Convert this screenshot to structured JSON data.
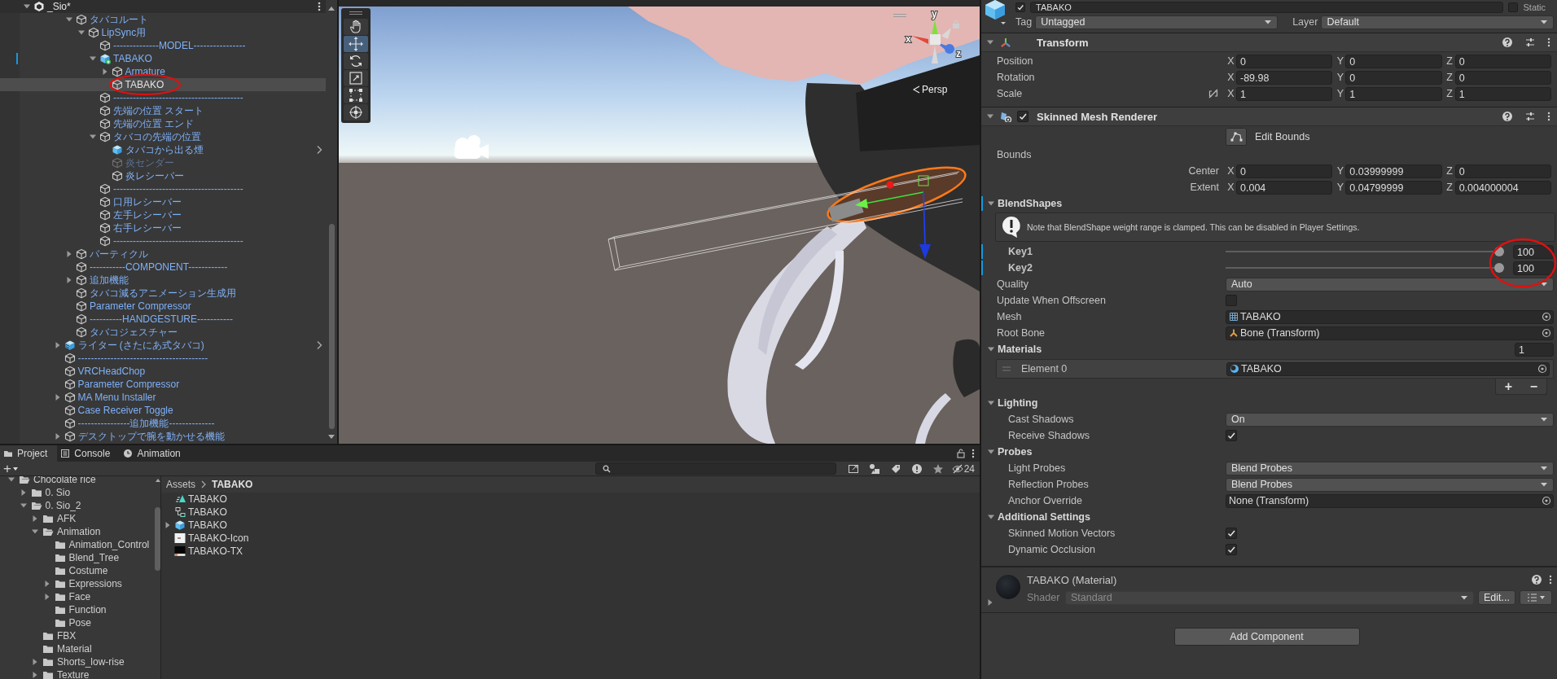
{
  "hierarchy": {
    "scene": {
      "label": "_Sio*",
      "expanded": true
    },
    "nested_nodes": [
      {
        "label": "タバコルート",
        "kind": "object",
        "expanded": true,
        "selected": false,
        "inactive": false,
        "overridden": false,
        "children": [
          {
            "label": "LipSync用",
            "kind": "object",
            "expanded": true,
            "selected": false,
            "inactive": false,
            "overridden": false,
            "children": [
              {
                "label": "--------------MODEL----------------",
                "kind": "object",
                "selected": false,
                "inactive": false,
                "overridden": false
              },
              {
                "label": "TABAKO",
                "kind": "model_added",
                "expanded": true,
                "selected": false,
                "inactive": false,
                "overridden": true,
                "children": [
                  {
                    "label": "Armature",
                    "kind": "object",
                    "expanded": false,
                    "selected": false,
                    "inactive": false,
                    "overridden": false
                  },
                  {
                    "label": "TABAKO",
                    "kind": "object",
                    "selected": true,
                    "inactive": false,
                    "overridden": false
                  }
                ]
              },
              {
                "label": "----------------------------------------",
                "kind": "object",
                "selected": false,
                "inactive": false,
                "overridden": false
              },
              {
                "label": "先端の位置 スタート",
                "kind": "object",
                "selected": false,
                "inactive": false,
                "overridden": false
              },
              {
                "label": "先端の位置 エンド",
                "kind": "object",
                "selected": false,
                "inactive": false,
                "overridden": false
              },
              {
                "label": "タバコの先端の位置",
                "kind": "object",
                "expanded": true,
                "selected": false,
                "inactive": false,
                "overridden": false,
                "children": [
                  {
                    "label": "タバコから出る煙",
                    "kind": "prefab",
                    "selected": false,
                    "inactive": false,
                    "overridden": false
                  },
                  {
                    "label": "炎センダー",
                    "kind": "object",
                    "selected": false,
                    "inactive": true,
                    "overridden": false
                  },
                  {
                    "label": "炎レシーバー",
                    "kind": "object",
                    "selected": false,
                    "inactive": false,
                    "overridden": false
                  }
                ]
              },
              {
                "label": "----------------------------------------",
                "kind": "object",
                "selected": false,
                "inactive": false,
                "overridden": false
              },
              {
                "label": "口用レシーバー",
                "kind": "object",
                "selected": false,
                "inactive": false,
                "overridden": false
              },
              {
                "label": "左手レシーバー",
                "kind": "object",
                "selected": false,
                "inactive": false,
                "overridden": false
              },
              {
                "label": "右手レシーバー",
                "kind": "object",
                "selected": false,
                "inactive": false,
                "overridden": false
              },
              {
                "label": "----------------------------------------",
                "kind": "object",
                "selected": false,
                "inactive": false,
                "overridden": false
              }
            ]
          }
        ]
      },
      {
        "label": "パーティクル",
        "kind": "object",
        "expanded": false,
        "selected": false,
        "inactive": false,
        "overridden": false
      },
      {
        "label": "-----------COMPONENT------------",
        "kind": "object",
        "selected": false,
        "inactive": false,
        "overridden": false
      },
      {
        "label": "追加機能",
        "kind": "object",
        "expanded": false,
        "selected": false,
        "inactive": false,
        "overridden": false
      },
      {
        "label": "タバコ減るアニメーション生成用",
        "kind": "object",
        "selected": false,
        "inactive": false,
        "overridden": false
      },
      {
        "label": "Parameter Compressor",
        "kind": "object",
        "selected": false,
        "inactive": false,
        "overridden": false
      },
      {
        "label": "----------HANDGESTURE-----------",
        "kind": "object",
        "selected": false,
        "inactive": false,
        "overridden": false
      },
      {
        "label": "タバコジェスチャー",
        "kind": "object",
        "selected": false,
        "inactive": false,
        "overridden": false
      }
    ],
    "nodes": [
      {
        "label": "ライター (さたにあ式タバコ)",
        "kind": "prefab_variant",
        "expanded": false,
        "selected": false,
        "inactive": false,
        "overridden": false
      },
      {
        "label": "----------------------------------------",
        "kind": "object",
        "selected": false,
        "inactive": false,
        "overridden": false
      },
      {
        "label": "VRCHeadChop",
        "kind": "object",
        "selected": false,
        "inactive": false,
        "overridden": false
      },
      {
        "label": "Parameter Compressor",
        "kind": "object",
        "selected": false,
        "inactive": false,
        "overridden": false
      },
      {
        "label": "MA Menu Installer",
        "kind": "object",
        "expanded": false,
        "selected": false,
        "inactive": false,
        "overridden": false
      },
      {
        "label": "Case Receiver Toggle",
        "kind": "object",
        "selected": false,
        "inactive": false,
        "overridden": false
      },
      {
        "label": "----------------追加機能--------------",
        "kind": "object",
        "selected": false,
        "inactive": false,
        "overridden": false
      },
      {
        "label": "デスクトップで腕を動かせる機能",
        "kind": "object",
        "expanded": false,
        "selected": false,
        "inactive": false,
        "overridden": false
      }
    ]
  },
  "scene": {
    "tools": [
      {
        "kind": "hand",
        "selected": false
      },
      {
        "kind": "move",
        "selected": true
      },
      {
        "kind": "rotate",
        "selected": false
      },
      {
        "kind": "scale",
        "selected": false
      },
      {
        "kind": "rect",
        "selected": false
      },
      {
        "kind": "transform",
        "selected": false
      }
    ],
    "axes": [
      "x",
      "y",
      "z"
    ],
    "projection": "Persp"
  },
  "inspector": {
    "object": {
      "name": "TABAKO",
      "active": true,
      "static_label": "Static",
      "static": false,
      "tag_label": "Tag",
      "tag": "Untagged",
      "layer_label": "Layer",
      "layer": "Default"
    },
    "components": [
      {
        "title": "Transform",
        "kind": "transform",
        "expanded": true,
        "rows": [
          {
            "kind": "vector3",
            "label": "Position",
            "fields": [
              {
                "axis": "X",
                "value": "0"
              },
              {
                "axis": "Y",
                "value": "0"
              },
              {
                "axis": "Z",
                "value": "0"
              }
            ]
          },
          {
            "kind": "vector3",
            "label": "Rotation",
            "fields": [
              {
                "axis": "X",
                "value": "-89.98"
              },
              {
                "axis": "Y",
                "value": "0"
              },
              {
                "axis": "Z",
                "value": "0"
              }
            ]
          },
          {
            "kind": "vector3",
            "label": "Scale",
            "proportional": false,
            "fields": [
              {
                "axis": "X",
                "value": "1"
              },
              {
                "axis": "Y",
                "value": "1"
              },
              {
                "axis": "Z",
                "value": "1"
              }
            ]
          }
        ]
      },
      {
        "title": "Skinned Mesh Renderer",
        "kind": "skinned_mesh_renderer",
        "enabled": true,
        "expanded": true,
        "rows": [
          {
            "kind": "button",
            "label": "Edit Bounds"
          },
          {
            "kind": "label",
            "label": "Bounds"
          },
          {
            "kind": "vector3_sub",
            "label": "Center",
            "fields": [
              {
                "axis": "X",
                "value": "0"
              },
              {
                "axis": "Y",
                "value": "0.03999999"
              },
              {
                "axis": "Z",
                "value": "0"
              }
            ]
          },
          {
            "kind": "vector3_sub",
            "label": "Extent",
            "fields": [
              {
                "axis": "X",
                "value": "0.004"
              },
              {
                "axis": "Y",
                "value": "0.04799999"
              },
              {
                "axis": "Z",
                "value": "0.004000004"
              }
            ]
          },
          {
            "kind": "foldout",
            "label": "BlendShapes",
            "expanded": true,
            "overridden": true,
            "children": [
              {
                "kind": "note",
                "text": "Note that BlendShape weight range is clamped. This can be disabled in Player Settings."
              },
              {
                "kind": "slider",
                "label": "Key1",
                "level": 1,
                "value": "100",
                "overridden": true
              },
              {
                "kind": "slider",
                "label": "Key2",
                "level": 1,
                "value": "100",
                "overridden": true
              }
            ]
          },
          {
            "kind": "dropdown",
            "label": "Quality",
            "value": "Auto"
          },
          {
            "kind": "checkbox",
            "label": "Update When Offscreen",
            "checked": false
          },
          {
            "kind": "mesh_field",
            "label": "Mesh",
            "value": "TABAKO"
          },
          {
            "kind": "bone_field",
            "label": "Root Bone",
            "value": "Bone (Transform)"
          },
          {
            "kind": "foldout",
            "label": "Materials",
            "expanded": true,
            "overridden": false,
            "count": "1",
            "children": [
              {
                "kind": "list_element",
                "label": "Element 0",
                "value": "TABAKO"
              },
              {
                "kind": "list_buttons",
                "add": "+",
                "remove": "−"
              }
            ]
          },
          {
            "kind": "foldout",
            "label": "Lighting",
            "expanded": true,
            "overridden": false,
            "children": [
              {
                "kind": "dropdown",
                "label": "Cast Shadows",
                "value": "On"
              },
              {
                "kind": "checkbox",
                "label": "Receive Shadows",
                "checked": true
              }
            ]
          },
          {
            "kind": "foldout",
            "label": "Probes",
            "expanded": true,
            "overridden": false,
            "children": [
              {
                "kind": "dropdown",
                "label": "Light Probes",
                "value": "Blend Probes"
              },
              {
                "kind": "dropdown",
                "label": "Reflection Probes",
                "value": "Blend Probes"
              },
              {
                "kind": "object",
                "label": "Anchor Override",
                "value": "None (Transform)"
              }
            ]
          },
          {
            "kind": "foldout",
            "label": "Additional Settings",
            "expanded": true,
            "overridden": false,
            "children": [
              {
                "kind": "checkbox",
                "label": "Skinned Motion Vectors",
                "checked": true
              },
              {
                "kind": "checkbox",
                "label": "Dynamic Occlusion",
                "checked": true
              }
            ]
          }
        ]
      }
    ],
    "material": {
      "name": "TABAKO (Material)",
      "expanded": false,
      "shader_label": "Shader",
      "shader": "Standard",
      "edit": "Edit..."
    },
    "add_component": "Add Component"
  },
  "project": {
    "tabs": [
      {
        "label": "Project",
        "selected": true
      },
      {
        "label": "Console",
        "selected": false
      },
      {
        "label": "Animation",
        "selected": false
      }
    ],
    "create": "+",
    "hidden_count": "24",
    "folders": [
      {
        "label": "Chocolate rice",
        "expanded": true,
        "children": [
          {
            "label": "0. Sio",
            "expanded": false
          },
          {
            "label": "0. Sio_2",
            "expanded": true,
            "children": [
              {
                "label": "AFK",
                "expanded": false
              },
              {
                "label": "Animation",
                "expanded": true,
                "children": [
                  {
                    "label": "Animation_Control"
                  },
                  {
                    "label": "Blend_Tree"
                  },
                  {
                    "label": "Costume"
                  },
                  {
                    "label": "Expressions",
                    "expanded": false
                  },
                  {
                    "label": "Face",
                    "expanded": false
                  },
                  {
                    "label": "Function"
                  },
                  {
                    "label": "Pose"
                  }
                ]
              },
              {
                "label": "FBX"
              },
              {
                "label": "Material"
              },
              {
                "label": "Shorts_low-rise",
                "expanded": false
              },
              {
                "label": "Texture",
                "expanded": false
              }
            ]
          }
        ]
      }
    ],
    "breadcrumb": [
      "Assets",
      "TABAKO"
    ],
    "assets": [
      {
        "label": "TABAKO",
        "kind": "avatar"
      },
      {
        "label": "TABAKO",
        "kind": "prefab_link"
      },
      {
        "label": "TABAKO",
        "kind": "model",
        "expanded": false
      },
      {
        "label": "TABAKO-Icon",
        "kind": "texture_light"
      },
      {
        "label": "TABAKO-TX",
        "kind": "texture_dark"
      }
    ]
  }
}
